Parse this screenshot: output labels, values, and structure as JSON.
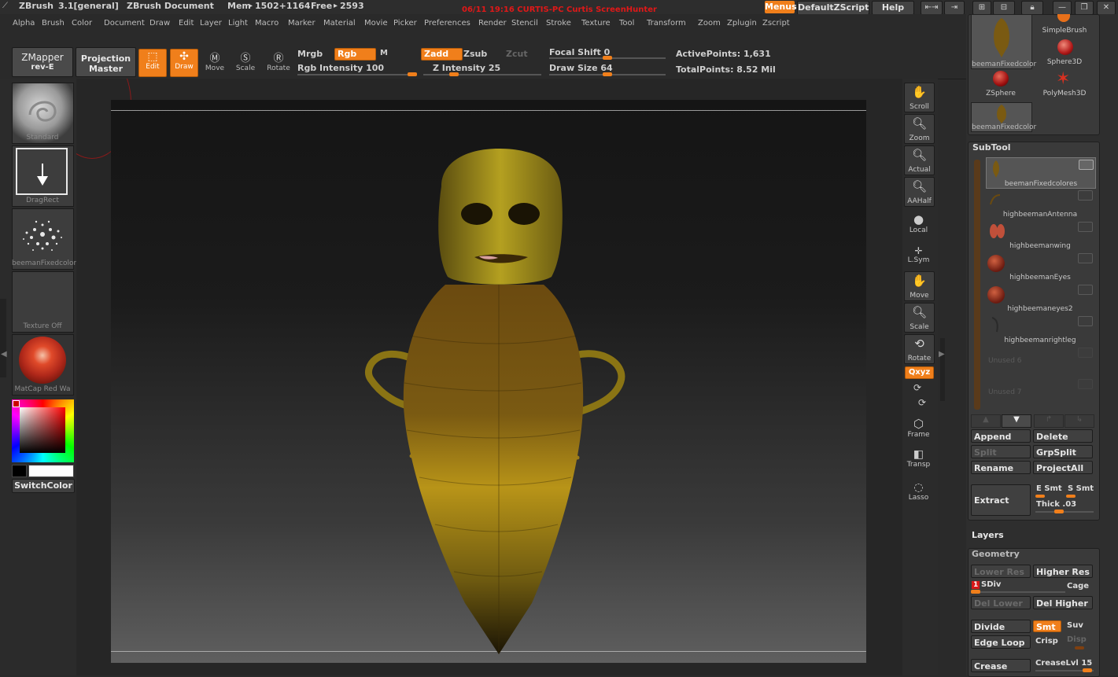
{
  "titlebar": {
    "app": "ZBrush",
    "version": "3.1[general]",
    "document": "ZBrush Document",
    "mem_label": "Mem",
    "mem_value": "1502+1164",
    "free_label": "Free",
    "free_value": "2593",
    "clock": "06/11  19:16  CURTIS-PC  Curtis  ScreenHunter",
    "menus_button": "Menus",
    "zscript_button": "DefaultZScript",
    "help_button": "Help"
  },
  "menubar": [
    "Alpha",
    "Brush",
    "Color",
    "Document",
    "Draw",
    "Edit",
    "Layer",
    "Light",
    "Macro",
    "Marker",
    "Material",
    "Movie",
    "Picker",
    "Preferences",
    "Render",
    "Stencil",
    "Stroke",
    "Texture",
    "Tool",
    "Transform",
    "Zoom",
    "Zplugin",
    "Zscript"
  ],
  "toolbar": {
    "zmapper": "ZMapper",
    "zmapper_sub": "rev-E",
    "projection": "Projection",
    "projection_sub": "Master",
    "edit": "Edit",
    "draw": "Draw",
    "move": "Move",
    "scale": "Scale",
    "rotate": "Rotate",
    "mrgb": "Mrgb",
    "rgb": "Rgb",
    "m": "M",
    "rgb_intensity": "Rgb Intensity 100",
    "zadd": "Zadd",
    "zsub": "Zsub",
    "zcut": "Zcut",
    "z_intensity": "Z Intensity 25",
    "focal_shift": "Focal Shift 0",
    "draw_size": "Draw Size 64",
    "active_points": "ActivePoints: 1,631",
    "total_points": "TotalPoints: 8.52  Mil"
  },
  "left_panel": {
    "brush_label": "Standard",
    "stroke_label": "DragRect",
    "alpha_label": "beemanFixedcolor",
    "texture_label": "Texture  Off",
    "material_label": "MatCap  Red  Wa",
    "switch_color": "SwitchColor"
  },
  "right_tools": [
    "Scroll",
    "Zoom",
    "Actual",
    "AAHalf",
    "Local",
    "L.Sym",
    "Move",
    "Scale",
    "Rotate",
    "Frame",
    "Transp",
    "Lasso"
  ],
  "xyz_button": "Qxyz",
  "tool_palette": {
    "items": [
      "beemanFixedcolor",
      "SimpleBrush",
      "Sphere3D",
      "ZSphere",
      "PolyMesh3D",
      "beemanFixedcolor"
    ]
  },
  "subtool": {
    "title": "SubTool",
    "items": [
      {
        "name": "beemanFixedcolores",
        "active": true
      },
      {
        "name": "highbeemanAntenna",
        "active": false
      },
      {
        "name": "highbeemanwing",
        "active": false
      },
      {
        "name": "highbeemanEyes",
        "active": false
      },
      {
        "name": "highbeemaneyes2",
        "active": false
      },
      {
        "name": "highbeemanrightleg",
        "active": false
      },
      {
        "name": "Unused  6",
        "active": false
      },
      {
        "name": "Unused  7",
        "active": false
      }
    ],
    "append": "Append",
    "delete": "Delete",
    "split": "Split",
    "grpsplit": "GrpSplit",
    "rename": "Rename",
    "projectall": "ProjectAll",
    "extract": "Extract",
    "e_smt": "E  Smt",
    "s_smt": "S  Smt",
    "thick": "Thick  .03"
  },
  "layers_title": "Layers",
  "geometry": {
    "title": "Geometry",
    "lower_res": "Lower  Res",
    "higher_res": "Higher  Res",
    "sdiv": "SDiv",
    "sdiv_value": "1",
    "cage": "Cage",
    "del_lower": "Del  Lower",
    "del_higher": "Del  Higher",
    "divide": "Divide",
    "smt": "Smt",
    "suv": "Suv",
    "edge_loop": "Edge  Loop",
    "crisp": "Crisp",
    "disp": "Disp",
    "crease": "Crease",
    "crease_lvl": "CreaseLvl  15"
  },
  "colors": {
    "accent": "#f07f1b",
    "clock_red": "#e01818",
    "model_yellow": "#b89418"
  }
}
